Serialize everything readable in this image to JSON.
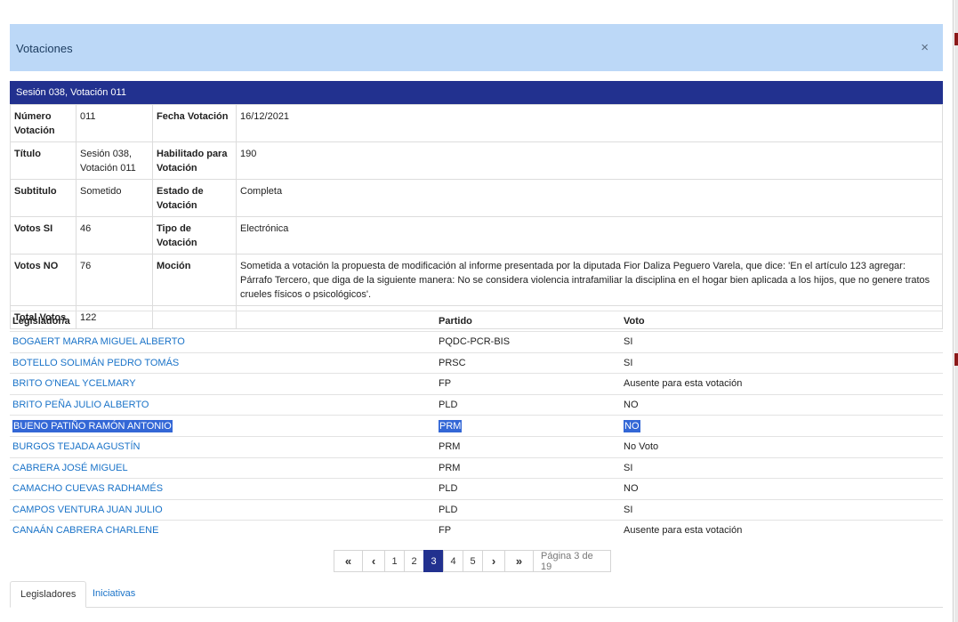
{
  "modal": {
    "title": "Votaciones",
    "close_icon": "×"
  },
  "session": {
    "title": "Sesión 038, Votación 011"
  },
  "info": {
    "numero_label": "Número Votación",
    "numero": "011",
    "fecha_label": "Fecha Votación",
    "fecha": "16/12/2021",
    "titulo_label": "Título",
    "titulo": "Sesión 038, Votación 011",
    "habilitado_label": "Habilitado para Votación",
    "habilitado": "190",
    "subtitulo_label": "Subtitulo",
    "subtitulo": "Sometido",
    "estado_label": "Estado de Votación",
    "estado": "Completa",
    "si_label": "Votos SI",
    "si": "46",
    "tipo_label": "Tipo de Votación",
    "tipo": "Electrónica",
    "no_label": "Votos NO",
    "no": "76",
    "mocion_label": "Moción",
    "mocion": "Sometida a votación la propuesta de modificación al informe presentada por la diputada Fior Daliza Peguero Varela, que dice: 'En el artículo 123 agregar: Párrafo Tercero, que diga de la siguiente manera: No se considera violencia intrafamiliar la disciplina en el hogar bien aplicada a los hijos, que no genere tratos crueles físicos o psicológicos'.",
    "total_label": "Total Votos",
    "total": "122"
  },
  "legisladores": {
    "headers": {
      "legislador": "Legislador/a",
      "partido": "Partido",
      "voto": "Voto"
    },
    "rows": [
      {
        "name": "BOGAERT MARRA MIGUEL ALBERTO",
        "partido": "PQDC-PCR-BIS",
        "voto": "SI"
      },
      {
        "name": "BOTELLO SOLIMÁN PEDRO TOMÁS",
        "partido": "PRSC",
        "voto": "SI"
      },
      {
        "name": "BRITO O'NEAL YCELMARY",
        "partido": "FP",
        "voto": "Ausente para esta votación"
      },
      {
        "name": "BRITO PEÑA JULIO ALBERTO",
        "partido": "PLD",
        "voto": "NO"
      },
      {
        "name": "BUENO PATIÑO RAMÓN ANTONIO",
        "partido": "PRM",
        "voto": "NO"
      },
      {
        "name": "BURGOS TEJADA AGUSTÍN",
        "partido": "PRM",
        "voto": "No Voto"
      },
      {
        "name": "CABRERA JOSÉ MIGUEL",
        "partido": "PRM",
        "voto": "SI"
      },
      {
        "name": "CAMACHO CUEVAS RADHAMÉS",
        "partido": "PLD",
        "voto": "NO"
      },
      {
        "name": "CAMPOS VENTURA JUAN JULIO",
        "partido": "PLD",
        "voto": "SI"
      },
      {
        "name": "CANAÁN CABRERA CHARLENE",
        "partido": "FP",
        "voto": "Ausente para esta votación"
      }
    ]
  },
  "pager": {
    "first": "«",
    "prev": "‹",
    "next": "›",
    "last": "»",
    "pages": [
      "1",
      "2",
      "3",
      "4",
      "5"
    ],
    "active_page": "3",
    "info": "Página 3 de 19"
  },
  "tabs": {
    "legisladores": "Legisladores",
    "iniciativas": "Iniciativas"
  }
}
